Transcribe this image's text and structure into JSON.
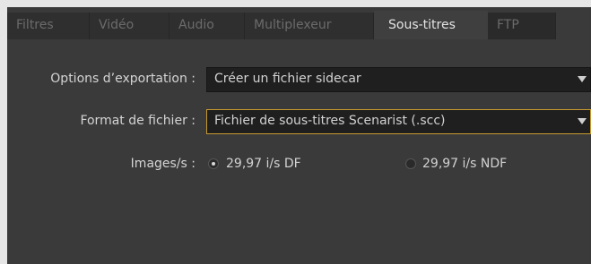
{
  "tabs": [
    {
      "label": "Filtres",
      "active": false
    },
    {
      "label": "Vidéo",
      "active": false
    },
    {
      "label": "Audio",
      "active": false
    },
    {
      "label": "Multiplexeur",
      "active": false
    },
    {
      "label": "Sous-titres",
      "active": true
    },
    {
      "label": "FTP",
      "active": false
    }
  ],
  "export_options": {
    "label": "Options d’exportation :",
    "value": "Créer un fichier sidecar"
  },
  "file_format": {
    "label": "Format de fichier :",
    "value": "Fichier de sous-titres Scenarist (.scc)"
  },
  "frame_rate": {
    "label": "Images/s :",
    "options": [
      {
        "label": "29,97 i/s DF",
        "selected": true
      },
      {
        "label": "29,97 i/s NDF",
        "selected": false
      }
    ]
  },
  "colors": {
    "panel_bg": "#3a3a3a",
    "focus_border": "#c89a30"
  },
  "icons": {
    "dropdown_arrow": "chevron-down-icon",
    "radio": "radio-button-icon"
  }
}
